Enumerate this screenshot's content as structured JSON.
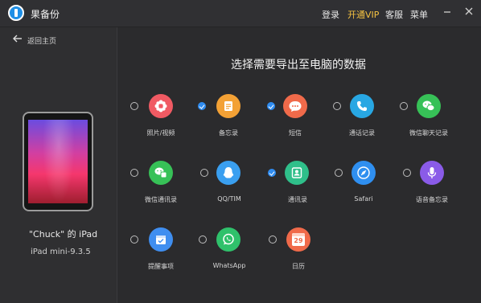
{
  "app": {
    "title": "果备份"
  },
  "topmenu": {
    "login": "登录",
    "vip": "开通VIP",
    "service": "客服",
    "menu": "菜单"
  },
  "sidebar": {
    "back_label": "返回主页",
    "device_name": "\"Chuck\" 的 iPad",
    "device_model": "iPad mini-9.3.5"
  },
  "main": {
    "title": "选择需要导出至电脑的数据",
    "items": [
      {
        "label": "照片/视频",
        "checked": false,
        "icon": "flower-icon",
        "color": "#f05a63"
      },
      {
        "label": "备忘录",
        "checked": true,
        "icon": "note-icon",
        "color": "#f3a135"
      },
      {
        "label": "短信",
        "checked": true,
        "icon": "message-icon",
        "color": "#f06a4a"
      },
      {
        "label": "通话记录",
        "checked": false,
        "icon": "phone-icon",
        "color": "#28a7e3"
      },
      {
        "label": "微信聊天记录",
        "checked": false,
        "icon": "wechat-icon",
        "color": "#37c157"
      },
      {
        "label": "微信通讯录",
        "checked": false,
        "icon": "wechat-contacts-icon",
        "color": "#37c157"
      },
      {
        "label": "QQ/TIM",
        "checked": false,
        "icon": "qq-icon",
        "color": "#3a9ff0"
      },
      {
        "label": "通讯录",
        "checked": true,
        "icon": "contacts-icon",
        "color": "#2fbf8a"
      },
      {
        "label": "Safari",
        "checked": false,
        "icon": "safari-icon",
        "color": "#2f8ff0"
      },
      {
        "label": "语音备忘录",
        "checked": false,
        "icon": "microphone-icon",
        "color": "#8a5be8"
      },
      {
        "label": "提醒事项",
        "checked": false,
        "icon": "reminder-icon",
        "color": "#3f8ef0"
      },
      {
        "label": "WhatsApp",
        "checked": false,
        "icon": "whatsapp-icon",
        "color": "#2fc16b"
      },
      {
        "label": "日历",
        "checked": false,
        "icon": "calendar-icon",
        "color": "#f06a4a"
      }
    ]
  },
  "calendar_day": "29"
}
